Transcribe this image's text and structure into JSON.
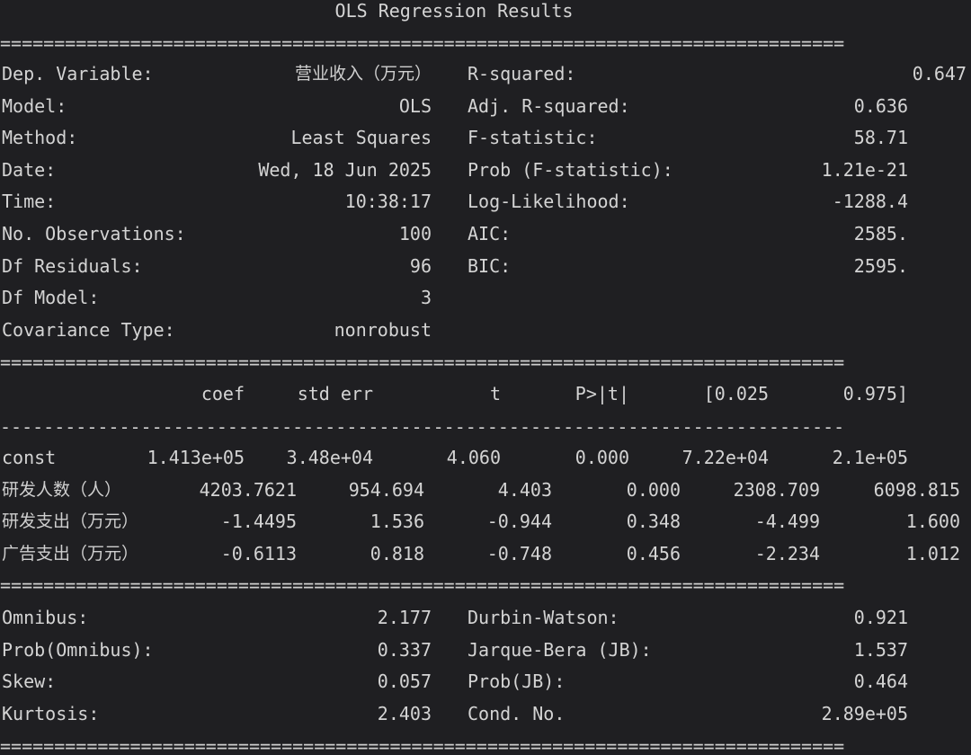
{
  "title": "OLS Regression Results",
  "top": [
    {
      "l": "Dep. Variable:",
      "lv": "营业收入（万元）",
      "r": "R-squared:",
      "rv": "0.647"
    },
    {
      "l": "Model:",
      "lv": "OLS",
      "r": "Adj. R-squared:",
      "rv": "0.636"
    },
    {
      "l": "Method:",
      "lv": "Least Squares",
      "r": "F-statistic:",
      "rv": "58.71"
    },
    {
      "l": "Date:",
      "lv": "Wed, 18 Jun 2025",
      "r": "Prob (F-statistic):",
      "rv": "1.21e-21"
    },
    {
      "l": "Time:",
      "lv": "10:38:17",
      "r": "Log-Likelihood:",
      "rv": "-1288.4"
    },
    {
      "l": "No. Observations:",
      "lv": "100",
      "r": "AIC:",
      "rv": "2585."
    },
    {
      "l": "Df Residuals:",
      "lv": "96",
      "r": "BIC:",
      "rv": "2595."
    },
    {
      "l": "Df Model:",
      "lv": "3",
      "r": "",
      "rv": ""
    },
    {
      "l": "Covariance Type:",
      "lv": "nonrobust",
      "r": "",
      "rv": ""
    }
  ],
  "coef_header": [
    "coef",
    "std err",
    "t",
    "P>|t|",
    "[0.025",
    "0.975]"
  ],
  "coef_rows": [
    {
      "name": "const",
      "vals": [
        "1.413e+05",
        "3.48e+04",
        "4.060",
        "0.000",
        "7.22e+04",
        "2.1e+05"
      ]
    },
    {
      "name": "研发人数（人）",
      "vals": [
        "4203.7621",
        "954.694",
        "4.403",
        "0.000",
        "2308.709",
        "6098.815"
      ]
    },
    {
      "name": "研发支出（万元）",
      "vals": [
        "-1.4495",
        "1.536",
        "-0.944",
        "0.348",
        "-4.499",
        "1.600"
      ]
    },
    {
      "name": "广告支出（万元）",
      "vals": [
        "-0.6113",
        "0.818",
        "-0.748",
        "0.456",
        "-2.234",
        "1.012"
      ]
    }
  ],
  "bottom": [
    {
      "l": "Omnibus:",
      "lv": "2.177",
      "r": "Durbin-Watson:",
      "rv": "0.921"
    },
    {
      "l": "Prob(Omnibus):",
      "lv": "0.337",
      "r": "Jarque-Bera (JB):",
      "rv": "1.537"
    },
    {
      "l": "Skew:",
      "lv": "0.057",
      "r": "Prob(JB):",
      "rv": "0.464"
    },
    {
      "l": "Kurtosis:",
      "lv": "2.403",
      "r": "Cond. No.",
      "rv": "2.89e+05"
    }
  ],
  "sep_double": "==============================================================================",
  "sep_single": "------------------------------------------------------------------------------"
}
